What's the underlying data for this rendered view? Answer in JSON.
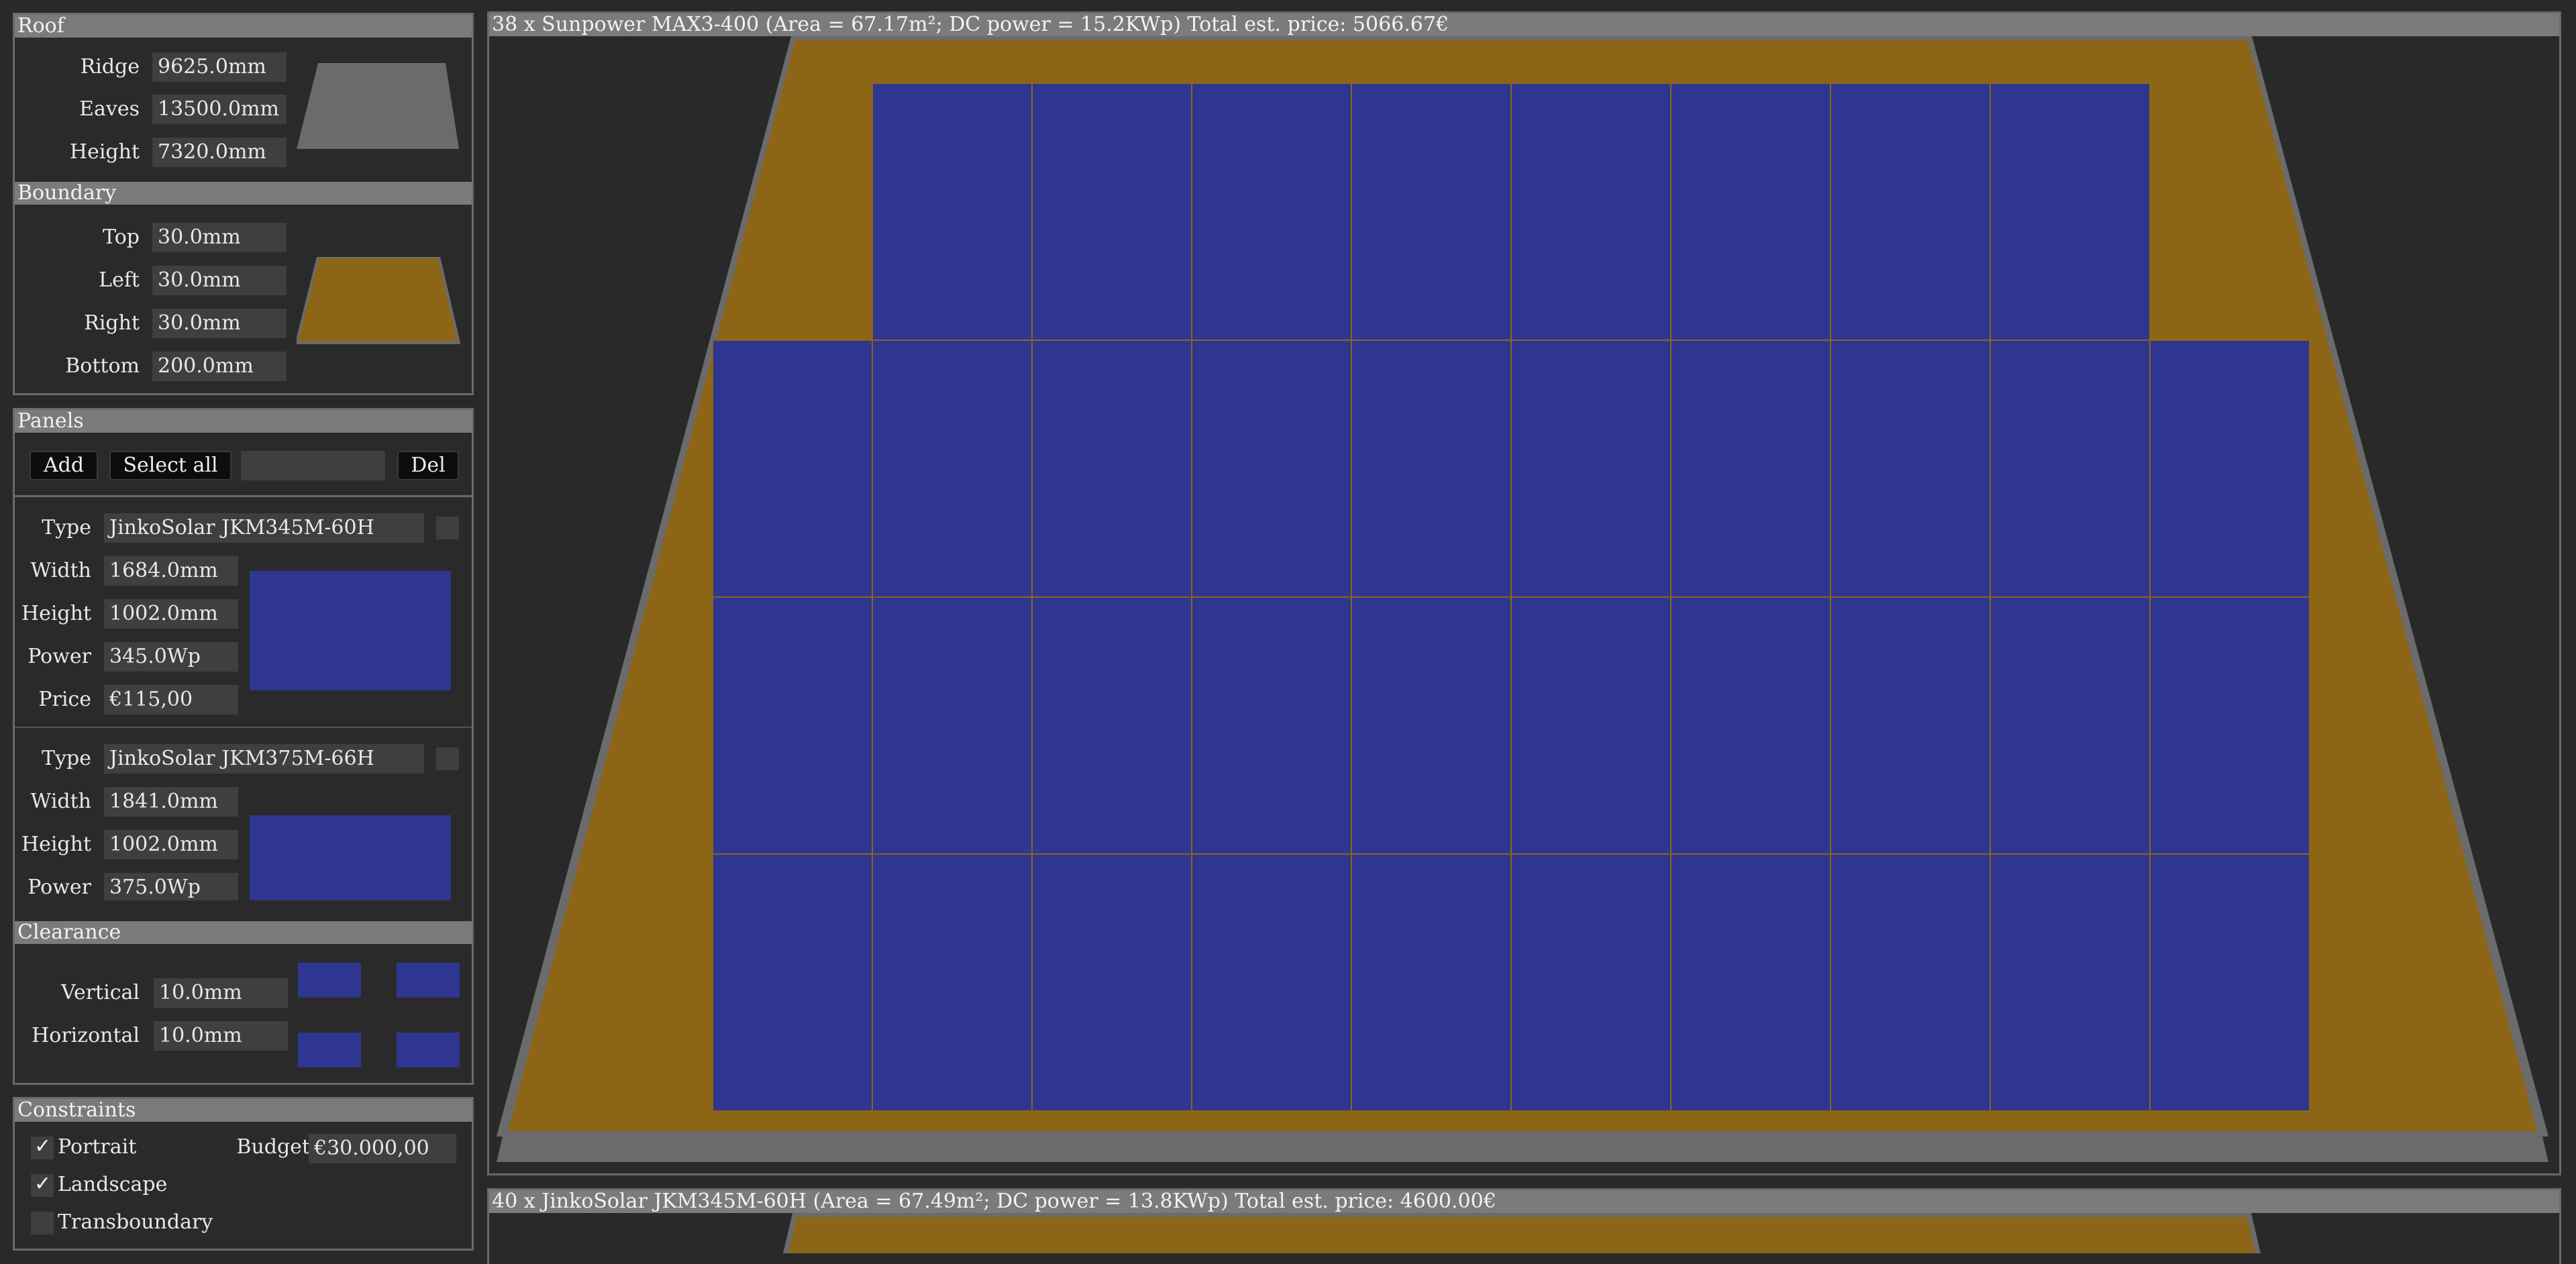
{
  "colors": {
    "roof": "#8d6517",
    "panel": "#2e3690",
    "border": "#6a6a6a",
    "gray": "#6b6b6b"
  },
  "roof": {
    "title": "Roof",
    "ridge_label": "Ridge",
    "ridge": "9625.0mm",
    "eaves_label": "Eaves",
    "eaves": "13500.0mm",
    "height_label": "Height",
    "height": "7320.0mm"
  },
  "boundary": {
    "title": "Boundary",
    "top_label": "Top",
    "top": "30.0mm",
    "left_label": "Left",
    "left": "30.0mm",
    "right_label": "Right",
    "right": "30.0mm",
    "bottom_label": "Bottom",
    "bottom": "200.0mm"
  },
  "panels": {
    "title": "Panels",
    "add_label": "Add",
    "select_all_label": "Select all",
    "filter_value": "",
    "del_label": "Del",
    "items": [
      {
        "type_label": "Type",
        "type": "JinkoSolar JKM345M-60H",
        "width_label": "Width",
        "width": "1684.0mm",
        "height_label": "Height",
        "height": "1002.0mm",
        "power_label": "Power",
        "power": "345.0Wp",
        "price_label": "Price",
        "price": "€115,00"
      },
      {
        "type_label": "Type",
        "type": "JinkoSolar JKM375M-66H",
        "width_label": "Width",
        "width": "1841.0mm",
        "height_label": "Height",
        "height": "1002.0mm",
        "power_label": "Power",
        "power": "375.0Wp"
      }
    ]
  },
  "clearance": {
    "title": "Clearance",
    "vertical_label": "Vertical",
    "vertical": "10.0mm",
    "horizontal_label": "Horizontal",
    "horizontal": "10.0mm"
  },
  "constraints": {
    "title": "Constraints",
    "portrait_label": "Portrait",
    "portrait": true,
    "landscape_label": "Landscape",
    "landscape": true,
    "transboundary_label": "Transboundary",
    "transboundary": false,
    "budget_label": "Budget",
    "budget": "€30.000,00"
  },
  "layouts": [
    {
      "summary": "38 x Sunpower MAX3-400 (Area = 67.17m²; DC power = 15.2KWp)  Total est. price: 5066.67€",
      "rows": [
        8,
        10,
        10,
        10
      ]
    },
    {
      "summary": "40 x JinkoSolar JKM345M-60H (Area = 67.49m²; DC power = 13.8KWp)  Total est. price: 4600.00€"
    }
  ]
}
